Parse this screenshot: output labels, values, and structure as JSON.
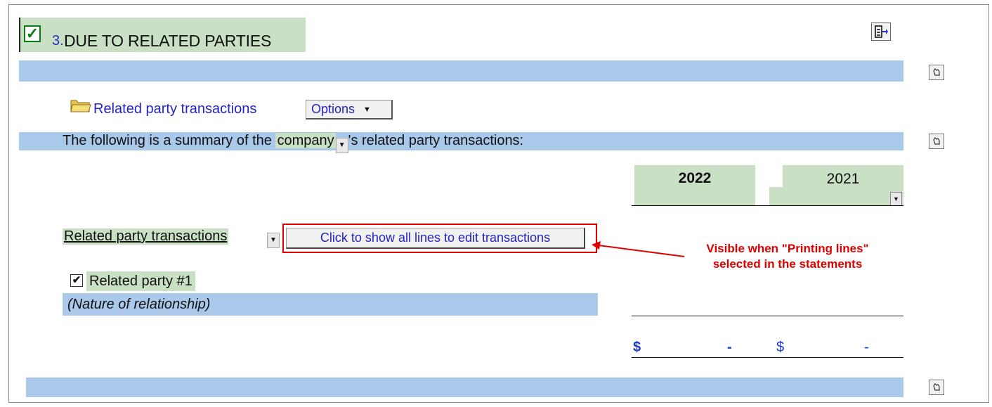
{
  "section": {
    "number": "3.",
    "title": "DUE TO RELATED PARTIES"
  },
  "icons": {
    "section_checkbox": "checkbox-checked-icon",
    "export": "export-arrow-icon",
    "row_tool": "pointer-hand-icon",
    "folder": "folder-icon",
    "dropdown": "chevron-down-icon"
  },
  "folder_item": {
    "label": "Related party transactions",
    "options_label": "Options"
  },
  "summary": {
    "prefix": "The following is a summary of the",
    "entity": "company",
    "suffix": "'s related party transactions:"
  },
  "columns": {
    "current_year": "2022",
    "prior_year": "2021"
  },
  "transactions": {
    "label": "Related party transactions",
    "show_lines_button": "Click to show all lines to edit transactions"
  },
  "callout": {
    "line1": "Visible when \"Printing lines\"",
    "line2": "selected in the statements",
    "color": "#e00000"
  },
  "party": {
    "checked": true,
    "label": "Related party #1",
    "relationship_placeholder": "(Nature of relationship)"
  },
  "totals": {
    "currency_current": "$",
    "value_current": "-",
    "currency_prior": "$",
    "value_prior": "-"
  },
  "colors": {
    "band_blue": "#a9c8ea",
    "highlight_green": "#c9e0c4",
    "link_blue": "#2424c4"
  }
}
